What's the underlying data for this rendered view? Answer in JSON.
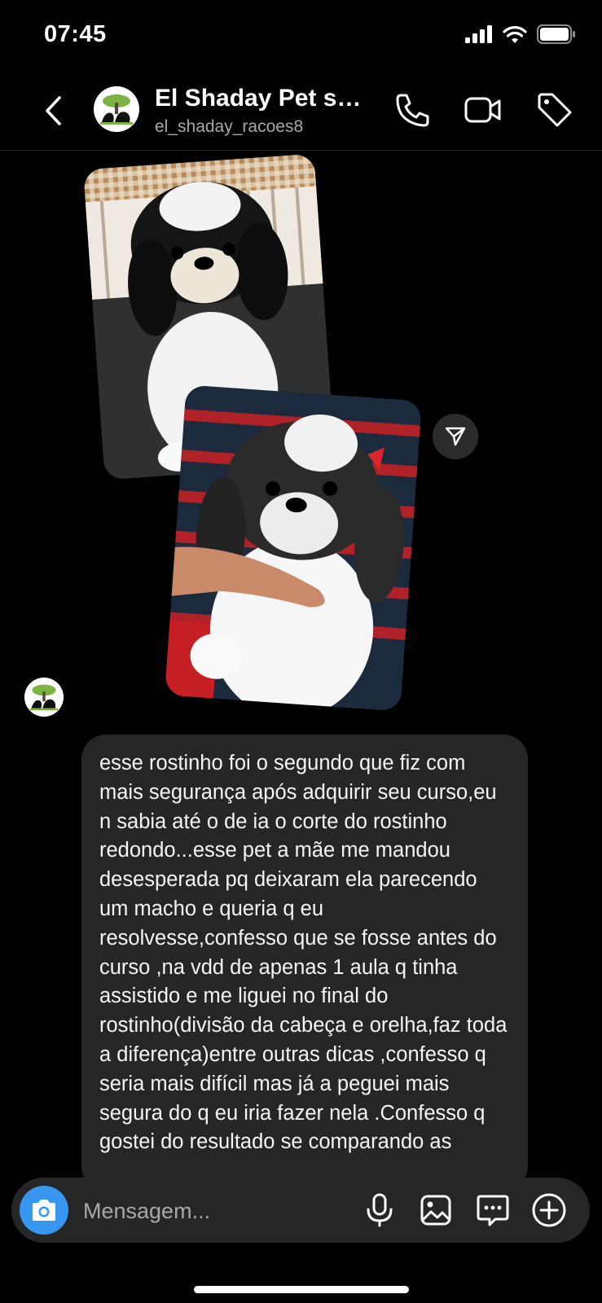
{
  "status_bar": {
    "time": "07:45"
  },
  "header": {
    "title": "El Shaday Pet sh...",
    "username": "el_shaday_racoes8"
  },
  "conversation": {
    "photos": [
      {
        "description_icon": "dog-photo-before"
      },
      {
        "description_icon": "dog-photo-after"
      }
    ],
    "message_text": "esse rostinho foi o segundo que fiz com mais segurança após adquirir seu curso,eu n sabia até o de ia o corte do rostinho redondo...esse pet a mãe me mandou desesperada pq deixaram ela parecendo um macho e queria q eu resolvesse,confesso que se fosse antes do curso ,na vdd de apenas 1 aula q tinha assistido e me liguei no final do rostinho(divisão da cabeça e orelha,faz toda a diferença)entre outras dicas ,confesso q seria mais difícil mas já a peguei mais segura do q eu iria fazer nela .Confesso q gostei do resultado se comparando as"
  },
  "composer": {
    "placeholder": "Mensagem..."
  },
  "colors": {
    "background": "#000000",
    "bubble": "#262626",
    "accent": "#3797f0",
    "secondary_text": "#a8a8a8"
  },
  "icons": [
    "back-icon",
    "phone-icon",
    "video-icon",
    "tag-icon",
    "send-icon",
    "camera-icon",
    "microphone-icon",
    "gallery-icon",
    "sticker-icon",
    "plus-icon"
  ]
}
